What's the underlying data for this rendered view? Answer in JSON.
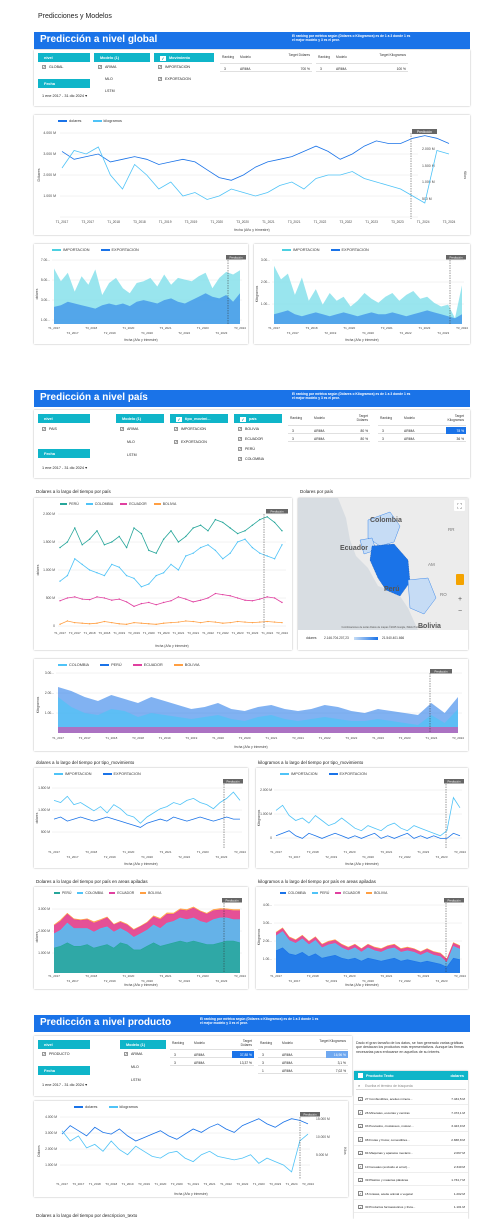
{
  "page_title": "Predicciones y Modelos",
  "sections": {
    "global": {
      "title": "Predicción a nivel global",
      "description": "El ranking por métrica según (Dólares o Kilogramos) es de 1 a 3 donde 1 es el mejor modelo y 3 es el peor.",
      "nivel_label": "nivel",
      "nivel_value": "GLOBAL",
      "modelo_label": "Modelo (1)",
      "modelos": [
        "ARIMA",
        "MLO",
        "LSTM"
      ],
      "movimiento_label": "Movimiento",
      "movimientos": [
        "IMPORTACION",
        "EXPORTACION"
      ],
      "fecha_label": "Fecha",
      "fecha_value": "1 ene 2017 - 31 dic 2024",
      "table_dolares": {
        "headers": [
          "Ranking",
          "Modelo",
          "Target Dólares"
        ],
        "rows": [
          [
            "3",
            "ARIMA",
            "700 %"
          ]
        ]
      },
      "table_kg": {
        "headers": [
          "Ranking",
          "Modelo",
          "Target Kilogramos"
        ],
        "rows": [
          [
            "3",
            "ARIMA",
            "100 %"
          ]
        ]
      },
      "main_legend": [
        "dolares",
        "kilogramos"
      ],
      "axis_x": "fecha (Año y trimestre)",
      "y_left": "Dólares",
      "y_right": "Kilos",
      "left_ticks": [
        "4.000 M",
        "3.000 M",
        "2.000 M",
        "1.000 M"
      ],
      "right_ticks": [
        "2.500 M",
        "2.000 M",
        "1.500 M",
        "1.000 M",
        "500 M"
      ],
      "small_legend": [
        "IMPORTACION",
        "EXPORTACION"
      ],
      "small_y_left": "dolares",
      "small_y_right": "Kilogramos",
      "small_ticks_left": [
        "7.00...",
        "5.00...",
        "3.00...",
        "1.00..."
      ],
      "small_ticks_right": [
        "3.00...",
        "2.00...",
        "1.00..."
      ]
    },
    "pais": {
      "title": "Predicción a nivel país",
      "description": "El ranking por métrica según (Dólares o Kilogramos) es de 1 a 3 donde 1 es el mejor modelo y 3 es el peor.",
      "nivel_label": "nivel",
      "nivel_value": "PAIS",
      "modelo_label": "Modelo (1)",
      "modelos": [
        "ARIMA",
        "MLO",
        "LSTM"
      ],
      "movimiento_label": "tipo_movimi...",
      "movimientos": [
        "IMPORTACION",
        "EXPORTACION"
      ],
      "pais_label": "país",
      "paises": [
        "BOLIVIA",
        "ECUADOR",
        "PERÚ",
        "COLOMBIA"
      ],
      "fecha_label": "Fecha",
      "fecha_value": "1 ene 2017 - 31 dic 2024",
      "table_dolares": {
        "headers": [
          "Ranking",
          "Modelo",
          "Target Dólares"
        ],
        "rows": [
          [
            "3",
            "ARIMA",
            "80 %"
          ],
          [
            "3",
            "ARIMA",
            "80 %"
          ]
        ]
      },
      "table_kg": {
        "headers": [
          "Ranking",
          "Modelo",
          "Target Kilogramos"
        ],
        "rows": [
          [
            "3",
            "ARIMA",
            "78 %"
          ],
          [
            "3",
            "ARIMA",
            "36 %"
          ]
        ]
      },
      "chart1_title": "Dolares a lo largo del tiempo por país",
      "map_title": "Dolares por país",
      "country_legend": [
        "PERÚ",
        "COLOMBIA",
        "ECUADOR",
        "BOLIVIA"
      ],
      "map_labels": [
        "Colombia",
        "Ecuador",
        "Perú",
        "Bolivia",
        "RR",
        "AM",
        "RO"
      ],
      "map_scale_label": "dolares",
      "map_scale_min": "2.146.704.207,23",
      "map_scale_max": "21.540.401.666",
      "map_attrib": "Combinaciones de teclas   Datos de mapas ©2025 Google, INEGI   Términos",
      "chart2_legend": [
        "COLOMBIA",
        "PERÚ",
        "ECUADOR",
        "BOLIVIA"
      ],
      "chart3_title": "dolares a lo largo del tiempo por tipo_movimiento",
      "chart4_title": "kilogramos a lo largo del tiempo por tipo_movimiento",
      "chart5_title": "Dolares a lo largo del tiempo por país en areas apiladas",
      "chart6_title": "kilogramos a lo largo del tiempo por país en areas apiladas",
      "chart5_legend": [
        "PERÚ",
        "COLOMBIA",
        "ECUADOR",
        "BOLIVIA"
      ],
      "chart6_legend": [
        "COLOMBIA",
        "PERÚ",
        "ECUADOR",
        "BOLIVIA"
      ]
    },
    "producto": {
      "title": "Predicción a nivel producto",
      "description": "El ranking por métrica según (Dólares o Kilogramos) es de 1 a 3 donde 1 es el mejor modelo y 3 es el peor.",
      "nivel_label": "nivel",
      "nivel_value": "PRODUCTO",
      "modelo_label": "Modelo (1)",
      "modelos": [
        "ARIMA",
        "MLO",
        "LSTM"
      ],
      "fecha_label": "Fecha",
      "fecha_value": "1 ene 2017 - 31 dic 2024",
      "table_dolares": {
        "headers": [
          "Ranking",
          "Modelo",
          "Target Dólares"
        ],
        "rows": [
          [
            "3",
            "ARIMA",
            "37,88 %"
          ],
          [
            "3",
            "ARIMA",
            "13,37 %"
          ]
        ]
      },
      "table_kg": {
        "headers": [
          "Ranking",
          "Modelo",
          "Target Kilogramos"
        ],
        "rows": [
          [
            "3",
            "ARIMA",
            "16,96 %"
          ],
          [
            "3",
            "ARIMA",
            "3,1 %"
          ],
          [
            "1",
            "ARIMA",
            "7,02 %"
          ]
        ]
      },
      "note": "Dado el gran tamaño de los datos, se han generado varias gráficas que destacan los productos más representativos. Aunque las firmas necesarias para enfocarse en aquellos de su interés.",
      "prod_header": "Producto Texto",
      "prod_value_header": "dolares",
      "search_placeholder": "Escriba el término de búsqueda",
      "products": [
        {
          "name": "27 Combustibles, aceites minera...",
          "value": "7.434,5 M"
        },
        {
          "name": "26 Minerales, escorias y cenizas",
          "value": "7.473,1 M"
        },
        {
          "name": "03 Pescados, crustáceos, molusc...",
          "value": "3.423,9 M"
        },
        {
          "name": "08 Frutas y frutos; comestibles...",
          "value": "2.838,8 M"
        },
        {
          "name": "84 Máquinas y aparatos mecánic...",
          "value": "2.067 M"
        },
        {
          "name": "10 Cereales (excluido el arroz)...",
          "value": "2.340 M"
        },
        {
          "name": "39 Plástico y materias plásticas",
          "value": "1.734,7 M"
        },
        {
          "name": "15 Grasas, aceite animal o vegetal",
          "value": "1.202 M"
        },
        {
          "name": "30 Productos farmacéuticos y fruta...",
          "value": "1.101 M"
        }
      ],
      "main_legend": [
        "dolares",
        "kilogramos"
      ],
      "bottom_title": "Dolares a lo largo del tiempo por descripcion_texto"
    }
  },
  "prediction_badge": "Predicción",
  "x_ticks_a": [
    "T1_2017",
    "T3_2017",
    "T1_2018",
    "T3_2018",
    "T1_2019",
    "T3_2019",
    "T1_2020",
    "T3_2020",
    "T1_2021",
    "T3_2021",
    "T1_2022",
    "T3_2022",
    "T1_2023",
    "T3_2023",
    "T1_2024",
    "T3_2024"
  ],
  "x_ticks_b": [
    "T1_2017",
    "T4_2017",
    "T3_2018",
    "T2_2019",
    "T1_2020",
    "T4_2020",
    "T3_2021",
    "T2_2022",
    "T1_2023",
    "T4_2023",
    "T3_2024"
  ],
  "colors": {
    "blue": "#1a73e8",
    "teal": "#0fb5c9",
    "lightblue": "#4fc3f7",
    "peru": "#26a69a",
    "colombia": "#4fc3f7",
    "ecuador": "#e040a0",
    "bolivia": "#ff9f43"
  },
  "chart_data": [
    {
      "type": "line",
      "title": "",
      "series": [
        {
          "name": "dolares",
          "values": [
            3.3,
            3.0,
            3.1,
            3.2,
            2.9,
            3.0,
            3.1,
            3.0,
            2.8,
            2.9,
            3.0,
            2.9,
            2.6,
            2.3,
            2.2,
            2.4,
            2.7,
            2.9,
            3.0,
            3.1,
            3.3,
            3.5,
            3.3,
            3.0,
            3.2,
            3.5,
            3.7,
            3.6,
            3.6,
            3.8,
            3.9,
            3.8,
            3.6
          ]
        },
        {
          "name": "kilogramos",
          "values": [
            2.2,
            2.7,
            2.6,
            2.8,
            2.0,
            1.6,
            2.3,
            2.0,
            1.6,
            1.8,
            1.4,
            1.5,
            1.3,
            1.4,
            1.6,
            1.5,
            1.4,
            1.5,
            1.7,
            1.8,
            1.6,
            1.9,
            2.0,
            2.0,
            2.1,
            1.9,
            1.8,
            1.7,
            1.6,
            1.4,
            1.2,
            2.7,
            2.6
          ]
        }
      ]
    },
    {
      "type": "line",
      "title": "Dolares a lo largo del tiempo por país",
      "series": [
        {
          "name": "PERÚ",
          "values": [
            1400,
            1500,
            1750,
            1450,
            1550,
            1700,
            1450,
            1500,
            1600,
            1400,
            1750,
            1650,
            1350,
            1300,
            1550,
            1700,
            1500,
            1600,
            1750,
            1800,
            1700,
            1900,
            1850,
            1750,
            1650,
            1700,
            1800,
            1900,
            1950,
            1850,
            1700
          ]
        },
        {
          "name": "COLOMBIA",
          "values": [
            800,
            900,
            1200,
            1100,
            1000,
            950,
            900,
            1100,
            1050,
            900,
            850,
            700,
            750,
            900,
            950,
            1100,
            1000,
            1250,
            1300,
            1400,
            1450,
            1350,
            1200,
            1300,
            1500,
            1550,
            1400,
            1300,
            1250,
            1200,
            1450
          ]
        },
        {
          "name": "ECUADOR",
          "values": [
            450,
            500,
            520,
            480,
            470,
            520,
            500,
            460,
            480,
            430,
            350,
            400,
            420,
            380,
            420,
            450,
            520,
            480,
            430,
            460,
            500,
            580,
            560,
            540,
            500,
            460,
            450,
            480,
            520,
            500,
            420
          ]
        },
        {
          "name": "BOLIVIA",
          "values": [
            30,
            90,
            60,
            50,
            40,
            50,
            80,
            60,
            40,
            30,
            60,
            50,
            40,
            30,
            50,
            60,
            70,
            90,
            80,
            60,
            80,
            70,
            50,
            60,
            80,
            70,
            60,
            70,
            80,
            70,
            60
          ]
        }
      ]
    }
  ]
}
